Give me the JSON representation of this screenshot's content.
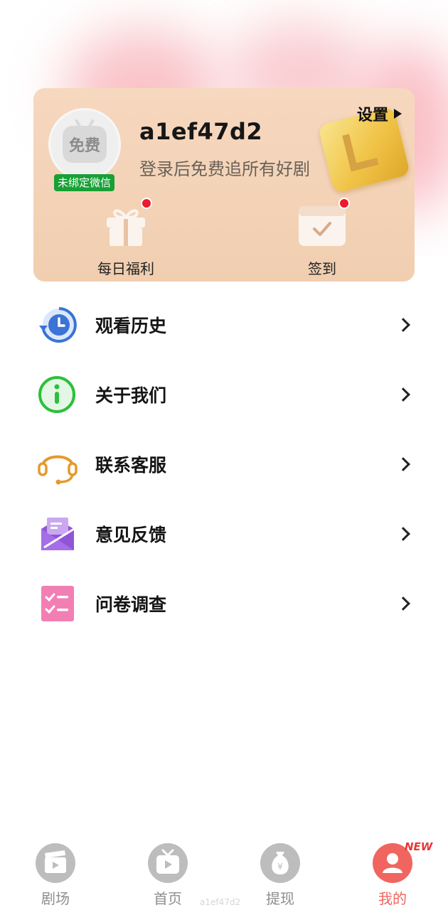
{
  "profile": {
    "username": "a1ef47d2",
    "subtitle": "登录后免费追所有好剧",
    "avatar_text": "免费",
    "wechat_badge": "未绑定微信",
    "settings_label": "设置"
  },
  "quick_actions": [
    {
      "label": "每日福利",
      "icon": "gift-icon",
      "has_dot": true
    },
    {
      "label": "签到",
      "icon": "calendar-check-icon",
      "has_dot": true
    }
  ],
  "menu": [
    {
      "label": "观看历史",
      "icon": "history-clock-icon"
    },
    {
      "label": "关于我们",
      "icon": "info-icon"
    },
    {
      "label": "联系客服",
      "icon": "headset-icon"
    },
    {
      "label": "意见反馈",
      "icon": "feedback-mail-icon"
    },
    {
      "label": "问卷调查",
      "icon": "checklist-icon"
    }
  ],
  "tabs": [
    {
      "label": "剧场",
      "icon": "clapperboard-icon",
      "active": false
    },
    {
      "label": "首页",
      "icon": "tv-play-icon",
      "active": false
    },
    {
      "label": "提现",
      "icon": "money-bag-icon",
      "active": false
    },
    {
      "label": "我的",
      "icon": "user-icon",
      "active": true
    }
  ],
  "new_badge": "NEW",
  "watermark": "a1ef47d2",
  "colors": {
    "accent": "#f0655f",
    "wechat_green": "#17a035",
    "card_bg": "#f3d2b6",
    "red_dot": "#ec1b2b"
  }
}
